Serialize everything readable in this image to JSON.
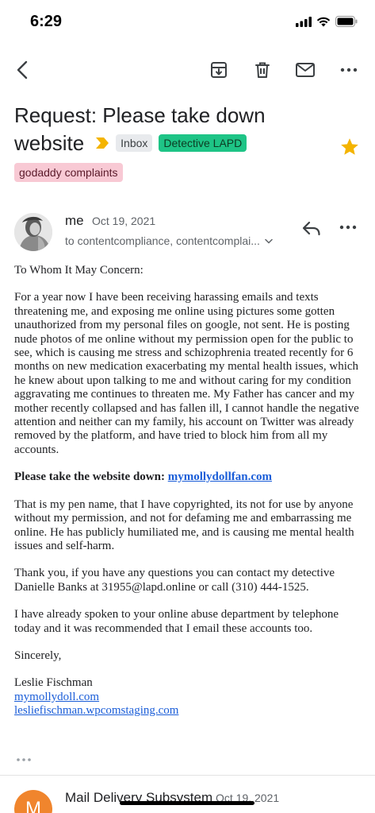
{
  "status": {
    "time": "6:29"
  },
  "toolbar": {
    "back_icon": "chevron-left-icon",
    "archive_icon": "archive-icon",
    "delete_icon": "trash-icon",
    "mark_unread_icon": "mail-icon",
    "more_icon": "more-horizontal-icon"
  },
  "email": {
    "subject_line1": "Request: Please take down",
    "subject_line2": "website",
    "labels": [
      "Inbox",
      "Detective LAPD"
    ],
    "extra_label": "godaddy complaints",
    "starred": true,
    "sender": "me",
    "date": "Oct 19, 2021",
    "recipients": "to contentcompliance, contentcomplai...",
    "body": {
      "greeting": "To Whom It May Concern:",
      "para1": "For a year now I have been receiving harassing emails and texts threatening me, and exposing me online using pictures some gotten unauthorized from my personal files on google, not sent. He is posting nude photos of me online without my permission open for the public to see, which is causing me stress and schizophrenia treated recently for 6 months on new medication exacerbating my mental health issues, which he knew about upon talking to me and without caring for my condition aggravating me continues to threaten me. My Father has cancer and my mother recently collapsed and has fallen ill, I cannot handle the negative attention and neither can my family, his account on Twitter was already removed by the platform, and have tried to block him from all my accounts.",
      "request_label": "Please take the website down:",
      "request_link": "mymollydollfan.com",
      "para2": "That is my pen name, that I have copyrighted, its not for use by anyone without my permission, and not for defaming me and embarrassing me online. He has publicly humiliated me, and is causing me mental health issues and self-harm.",
      "para3": "Thank you, if you have any questions you can contact my detective Danielle Banks at 31955@lapd.online or call (310) 444-1525.",
      "para4": "I have already spoken to your online abuse department by telephone today and it was recommended that I email these accounts too.",
      "closing": "Sincerely,",
      "signature_name": "Leslie Fischman",
      "signature_link1": "mymollydoll.com",
      "signature_link2": "lesliefischman.wpcomstaging.com"
    }
  },
  "next_message": {
    "avatar_letter": "M",
    "sender": "Mail Delivery Subsystem",
    "date": "Oct 19, 2021"
  },
  "colors": {
    "link": "#1a5dd8",
    "label_lapd": "#1ec486",
    "label_godaddy": "#f8c9d4",
    "star": "#f4b400",
    "importance": "#f4b400",
    "next_avatar": "#f0852d"
  }
}
